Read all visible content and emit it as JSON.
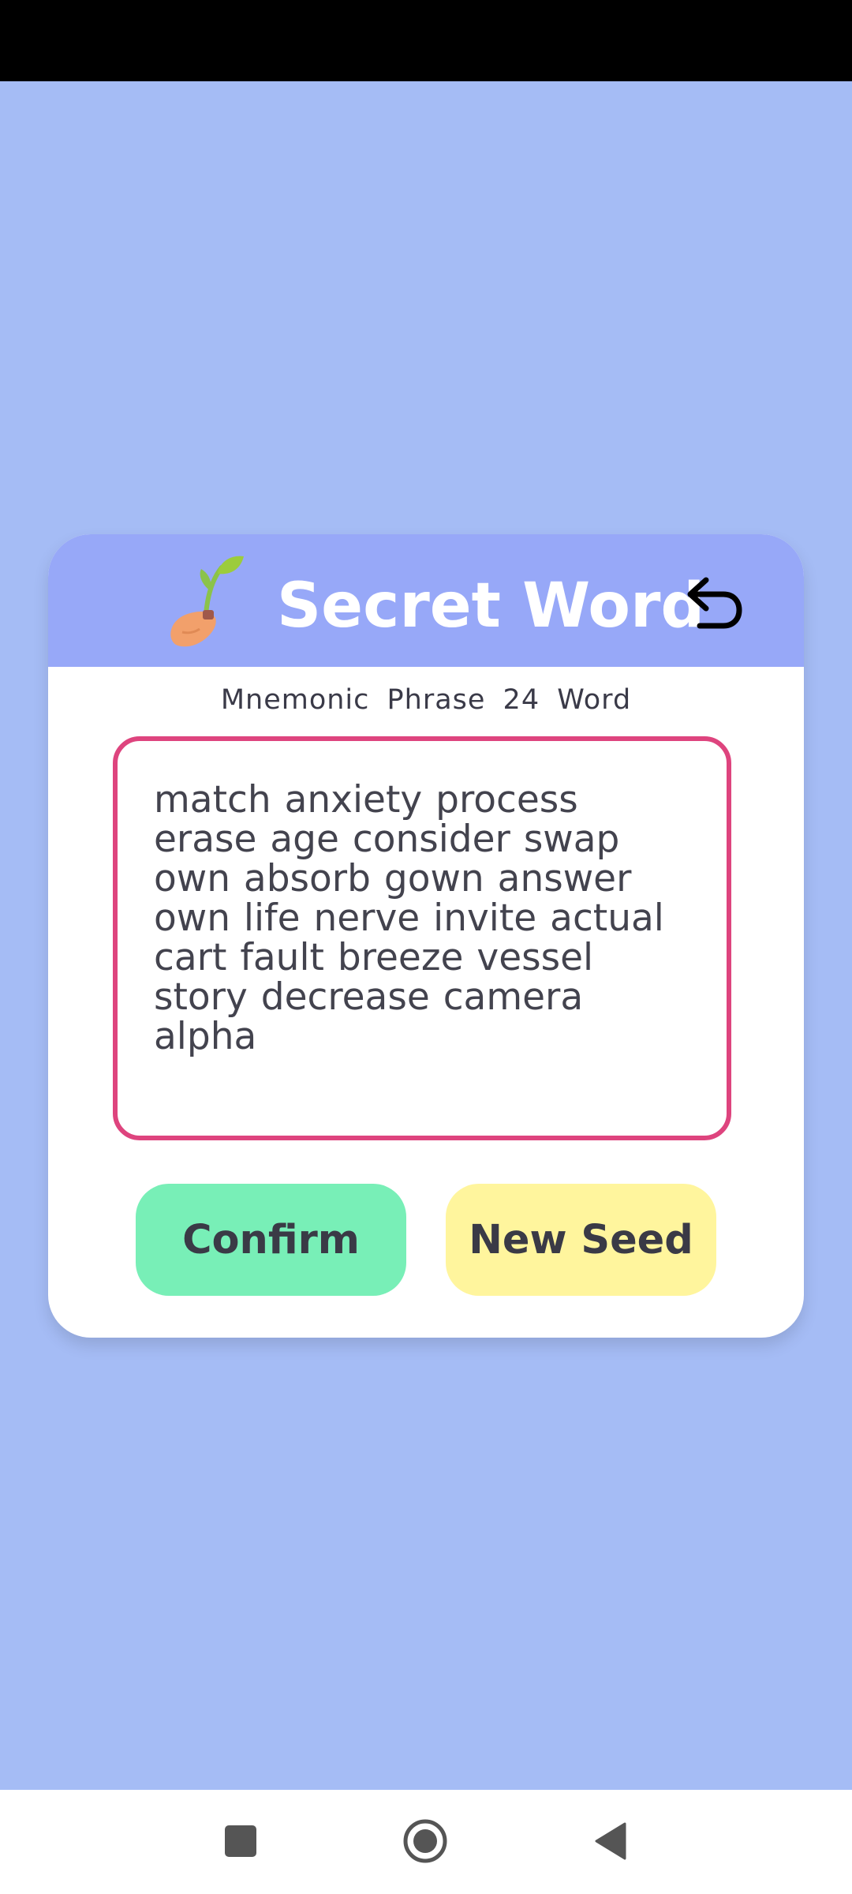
{
  "header": {
    "title": "Secret Word",
    "logo_icon": "sprout-seed-icon",
    "back_icon": "undo-arrow-icon"
  },
  "subtitle": "Mnemonic Phrase 24 Word",
  "mnemonic": {
    "lines": [
      "match anxiety process",
      "erase age consider swap",
      "own absorb gown answer",
      "own life nerve invite actual",
      "cart fault breeze vessel",
      "story decrease camera",
      "alpha"
    ]
  },
  "buttons": {
    "confirm_label": "Confirm",
    "new_seed_label": "New Seed"
  },
  "navigation": {
    "recents_icon": "square-recents-icon",
    "home_icon": "circle-home-icon",
    "back_icon": "triangle-back-icon"
  },
  "colors": {
    "background": "#a5bcf5",
    "header": "#97a8f8",
    "phrase_border": "#de447e",
    "confirm": "#78efb7",
    "new_seed": "#fff59d"
  }
}
